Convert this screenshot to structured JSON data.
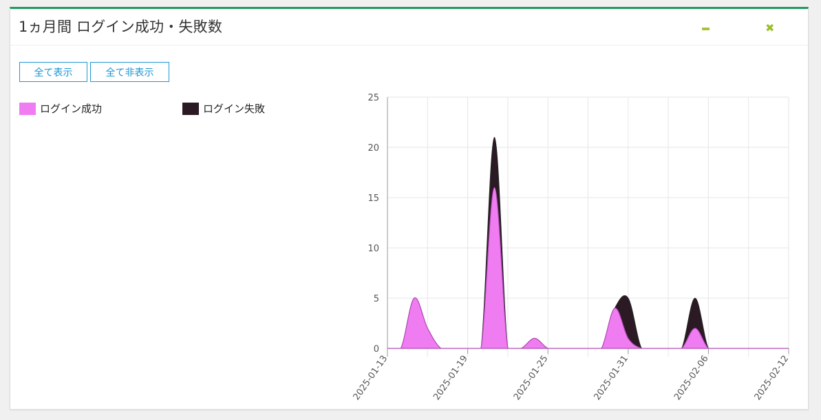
{
  "panel": {
    "title": "1ヵ月間 ログイン成功・失敗数",
    "minimize_icon": "minus-icon",
    "close_icon": "close-x-icon",
    "accent_color": "#1a9a5b",
    "button_color": "#9bbf2a"
  },
  "controls": {
    "show_all_label": "全て表示",
    "hide_all_label": "全て非表示"
  },
  "legend": [
    {
      "label": "ログイン成功",
      "color": "#f07cf2"
    },
    {
      "label": "ログイン失敗",
      "color": "#2b1a23"
    }
  ],
  "chart_data": {
    "type": "area",
    "stacked": true,
    "x_start": "2025-01-13",
    "x": [
      "2025-01-13",
      "2025-01-14",
      "2025-01-15",
      "2025-01-16",
      "2025-01-17",
      "2025-01-18",
      "2025-01-19",
      "2025-01-20",
      "2025-01-21",
      "2025-01-22",
      "2025-01-23",
      "2025-01-24",
      "2025-01-25",
      "2025-01-26",
      "2025-01-27",
      "2025-01-28",
      "2025-01-29",
      "2025-01-30",
      "2025-01-31",
      "2025-02-01",
      "2025-02-02",
      "2025-02-03",
      "2025-02-04",
      "2025-02-05",
      "2025-02-06",
      "2025-02-07",
      "2025-02-08",
      "2025-02-09",
      "2025-02-10",
      "2025-02-11",
      "2025-02-12"
    ],
    "series": [
      {
        "name": "ログイン成功",
        "color": "#f07cf2",
        "values": [
          0,
          0,
          5,
          2,
          0,
          0,
          0,
          0,
          16,
          0,
          0,
          1,
          0,
          0,
          0,
          0,
          0,
          4,
          1,
          0,
          0,
          0,
          0,
          2,
          0,
          0,
          0,
          0,
          0,
          0,
          0
        ]
      },
      {
        "name": "ログイン失敗",
        "color": "#2b1a23",
        "values": [
          0,
          0,
          0,
          0,
          0,
          0,
          0,
          0,
          5,
          0,
          0,
          0,
          0,
          0,
          0,
          0,
          0,
          0,
          4,
          0,
          0,
          0,
          0,
          3,
          0,
          0,
          0,
          0,
          0,
          0,
          0
        ]
      }
    ],
    "x_tick_labels": [
      "2025-01-13",
      "2025-01-19",
      "2025-01-25",
      "2025-01-31",
      "2025-02-06",
      "2025-02-12"
    ],
    "y_ticks": [
      0,
      5,
      10,
      15,
      20,
      25
    ],
    "ylim": [
      0,
      25
    ],
    "grid": true
  }
}
